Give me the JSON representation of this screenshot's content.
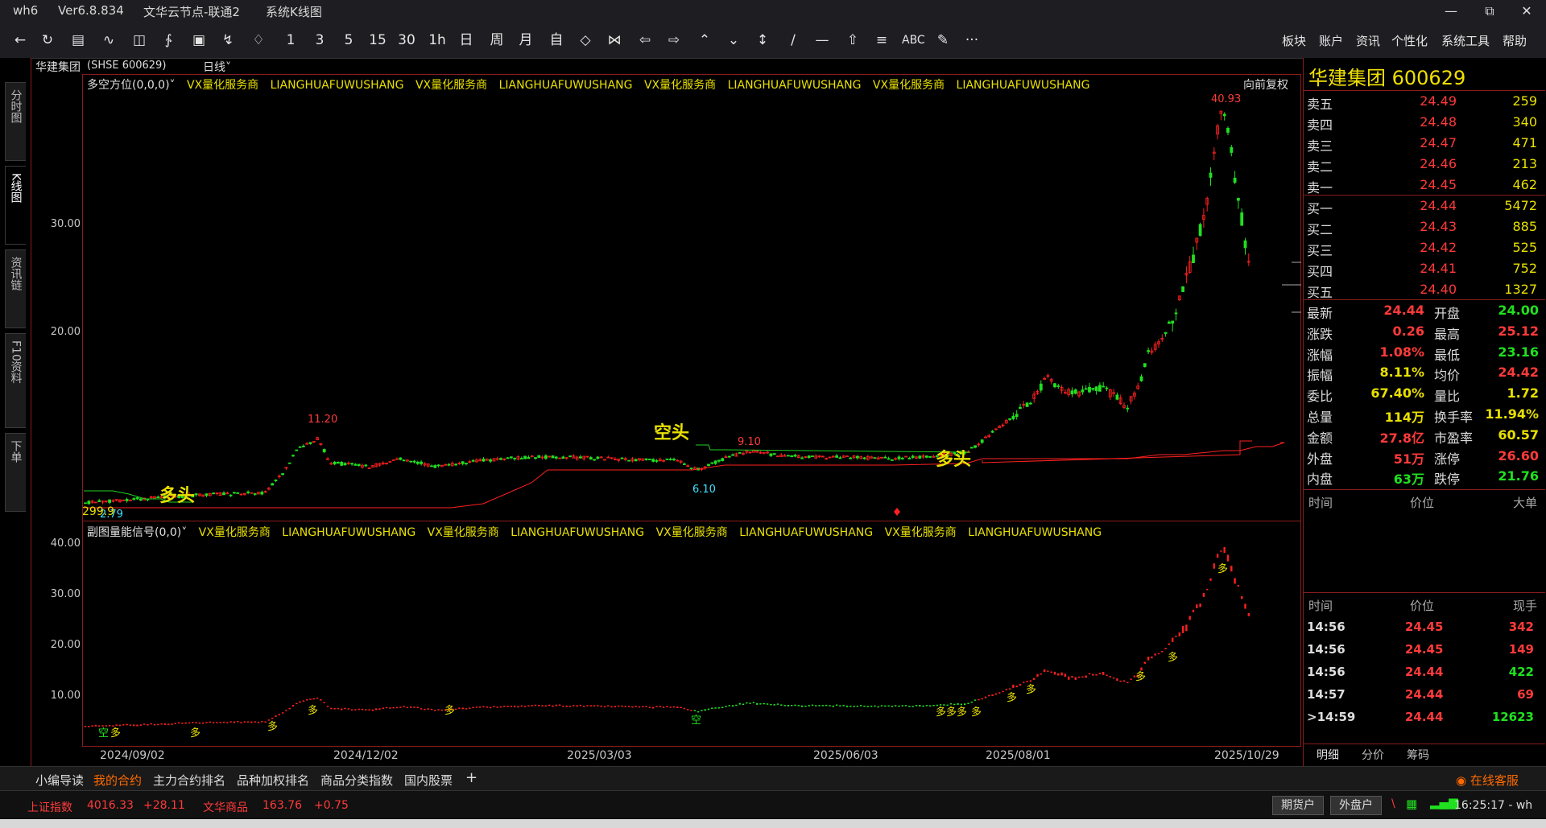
{
  "window": {
    "app": "wh6",
    "version": "Ver6.8.834",
    "server": "文华云节点-联通2",
    "view": "系统K线图"
  },
  "toolbar": {
    "periods": [
      "1",
      "3",
      "5",
      "15",
      "30",
      "1h",
      "日",
      "周",
      "月",
      "自"
    ],
    "text_tool": "ABC",
    "more": "···",
    "menus": [
      "板块",
      "账户",
      "资讯",
      "个性化",
      "系统工具",
      "帮助"
    ]
  },
  "left_tabs": [
    "分时图",
    "K线图",
    "资讯链",
    "F10资料",
    "下单"
  ],
  "chart": {
    "stock_name": "华建集团",
    "code_label": "(SHSE 600629)",
    "period": "日线",
    "main_indicator": "多空方位(0,0,0)",
    "sub_indicator": "副图量能信号(0,0)",
    "ad_text": "VX量化服务商",
    "ad_text2": "LIANGHUAFUWUSHANG",
    "adjust": "向前复权",
    "main_y_ticks": [
      "30.00",
      "20.00"
    ],
    "sub_y_ticks": [
      "40.00",
      "30.00",
      "20.00",
      "10.00"
    ],
    "x_ticks": [
      "2024/09/02",
      "2024/12/02",
      "2025/03/03",
      "2025/06/03",
      "2025/08/01",
      "2025/10/29"
    ],
    "annotations": {
      "high_max": "40.93",
      "high1": "11.20",
      "high2": "9.10",
      "low1": "6.10",
      "low0": "2.79",
      "left_val": "299.9",
      "long1": "多头",
      "short1": "空头",
      "long2": "多头",
      "sig_long": "多",
      "sig_short": "空"
    }
  },
  "quote": {
    "title": "华建集团 600629",
    "asks": [
      {
        "label": "卖五",
        "price": "24.49",
        "vol": "259"
      },
      {
        "label": "卖四",
        "price": "24.48",
        "vol": "340"
      },
      {
        "label": "卖三",
        "price": "24.47",
        "vol": "471"
      },
      {
        "label": "卖二",
        "price": "24.46",
        "vol": "213"
      },
      {
        "label": "卖一",
        "price": "24.45",
        "vol": "462"
      }
    ],
    "bids": [
      {
        "label": "买一",
        "price": "24.44",
        "vol": "5472"
      },
      {
        "label": "买二",
        "price": "24.43",
        "vol": "885"
      },
      {
        "label": "买三",
        "price": "24.42",
        "vol": "525"
      },
      {
        "label": "买四",
        "price": "24.41",
        "vol": "752"
      },
      {
        "label": "买五",
        "price": "24.40",
        "vol": "1327"
      }
    ],
    "stats": [
      {
        "l1": "最新",
        "v1": "24.44",
        "c1": "red",
        "l2": "开盘",
        "v2": "24.00",
        "c2": "green"
      },
      {
        "l1": "涨跌",
        "v1": "0.26",
        "c1": "red",
        "l2": "最高",
        "v2": "25.12",
        "c2": "red"
      },
      {
        "l1": "涨幅",
        "v1": "1.08%",
        "c1": "red",
        "l2": "最低",
        "v2": "23.16",
        "c2": "green"
      },
      {
        "l1": "振幅",
        "v1": "8.11%",
        "c1": "yellow",
        "l2": "均价",
        "v2": "24.42",
        "c2": "red"
      },
      {
        "l1": "委比",
        "v1": "67.40%",
        "c1": "yellow",
        "l2": "量比",
        "v2": "1.72",
        "c2": "yellow"
      },
      {
        "l1": "总量",
        "v1": "114万",
        "c1": "yellow",
        "l2": "换手率",
        "v2": "11.94%",
        "c2": "yellow"
      },
      {
        "l1": "金额",
        "v1": "27.8亿",
        "c1": "red",
        "l2": "市盈率",
        "v2": "60.57",
        "c2": "yellow"
      },
      {
        "l1": "外盘",
        "v1": "51万",
        "c1": "red",
        "l2": "涨停",
        "v2": "26.60",
        "c2": "red"
      },
      {
        "l1": "内盘",
        "v1": "63万",
        "c1": "green",
        "l2": "跌停",
        "v2": "21.76",
        "c2": "green"
      }
    ],
    "big_order_header": [
      "时间",
      "价位",
      "大单"
    ],
    "tick_header": [
      "时间",
      "价位",
      "现手"
    ],
    "ticks": [
      {
        "time": "14:56",
        "price": "24.45",
        "vol": "342",
        "vc": "red"
      },
      {
        "time": "14:56",
        "price": "24.45",
        "vol": "149",
        "vc": "red"
      },
      {
        "time": "14:56",
        "price": "24.44",
        "vol": "422",
        "vc": "green"
      },
      {
        "time": "14:57",
        "price": "24.44",
        "vol": "69",
        "vc": "red"
      },
      {
        "time": ">14:59",
        "price": "24.44",
        "vol": "12623",
        "vc": "green"
      }
    ],
    "tabs": [
      "明细",
      "分价",
      "筹码"
    ]
  },
  "bottom_tabs": [
    "小编导读",
    "我的合约",
    "主力合约排名",
    "品种加权排名",
    "商品分类指数",
    "国内股票"
  ],
  "bottom_add": "+",
  "service": "在线客服",
  "status": {
    "idx1_name": "上证指数",
    "idx1_val": "4016.33",
    "idx1_chg": "+28.11",
    "idx2_name": "文华商品",
    "idx2_val": "163.76",
    "idx2_chg": "+0.75",
    "btn1": "期货户",
    "btn2": "外盘户",
    "clock": "16:25:17 - wh"
  },
  "colors": {
    "up": "#ff3a3a",
    "down": "#20e020",
    "signal": "#e8e000",
    "frame": "#8a1c1c"
  }
}
